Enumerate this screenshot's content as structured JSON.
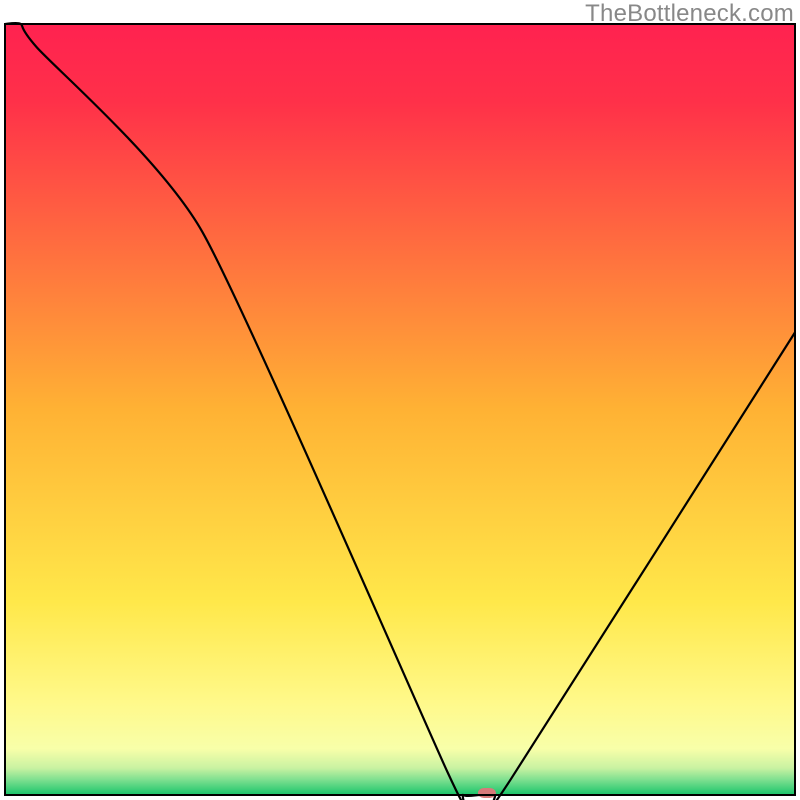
{
  "header": {
    "watermark": "TheBottleneck.com"
  },
  "chart_data": {
    "type": "line",
    "title": "",
    "xlabel": "",
    "ylabel": "",
    "xlim": [
      0,
      100
    ],
    "ylim": [
      0,
      100
    ],
    "x": [
      0,
      2,
      4,
      25,
      56,
      58,
      60,
      62,
      64,
      100
    ],
    "values": [
      100,
      100,
      97,
      73,
      3,
      0,
      0,
      0,
      2,
      60
    ],
    "marker": {
      "x": 61,
      "y": 0
    },
    "background": {
      "type": "vertical-gradient",
      "stops": [
        {
          "offset": 0.0,
          "color": "#ff2250"
        },
        {
          "offset": 0.1,
          "color": "#ff3049"
        },
        {
          "offset": 0.5,
          "color": "#ffb234"
        },
        {
          "offset": 0.75,
          "color": "#ffe84a"
        },
        {
          "offset": 0.88,
          "color": "#fff98a"
        },
        {
          "offset": 0.94,
          "color": "#f8ffa9"
        },
        {
          "offset": 0.965,
          "color": "#c9f2a2"
        },
        {
          "offset": 0.98,
          "color": "#7fe090"
        },
        {
          "offset": 1.0,
          "color": "#18c46a"
        }
      ]
    },
    "series_style": {
      "stroke": "#000000",
      "stroke_width": 2.2
    },
    "marker_style": {
      "fill": "#d77a7a",
      "rx": 6,
      "width": 18,
      "height": 10
    }
  }
}
